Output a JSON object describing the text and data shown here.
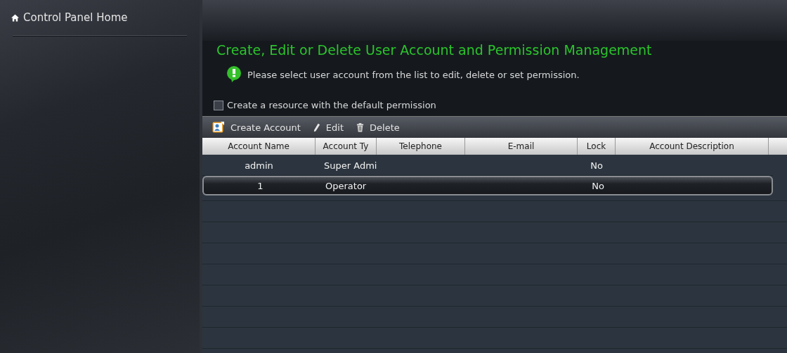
{
  "sidebar": {
    "home_link": "Control Panel Home"
  },
  "main": {
    "title": "Create, Edit or Delete User Account and Permission Management",
    "info": "Please select user account from the list to edit, delete or set permission.",
    "default_permission": {
      "label": "Create a resource with the default permission",
      "checked": false
    },
    "toolbar": [
      {
        "kind": "create",
        "label": "Create Account"
      },
      {
        "kind": "edit",
        "label": "Edit"
      },
      {
        "kind": "delete",
        "label": "Delete"
      }
    ],
    "table": {
      "columns": [
        "Account Name",
        "Account Ty",
        "Telephone",
        "E-mail",
        "Lock",
        "Account Description"
      ],
      "rows": [
        {
          "cells": [
            "admin",
            "Super Admi",
            "",
            "",
            "No",
            ""
          ],
          "selected": false
        },
        {
          "cells": [
            "1",
            "Operator",
            "",
            "",
            "No",
            ""
          ],
          "selected": true
        }
      ]
    }
  }
}
